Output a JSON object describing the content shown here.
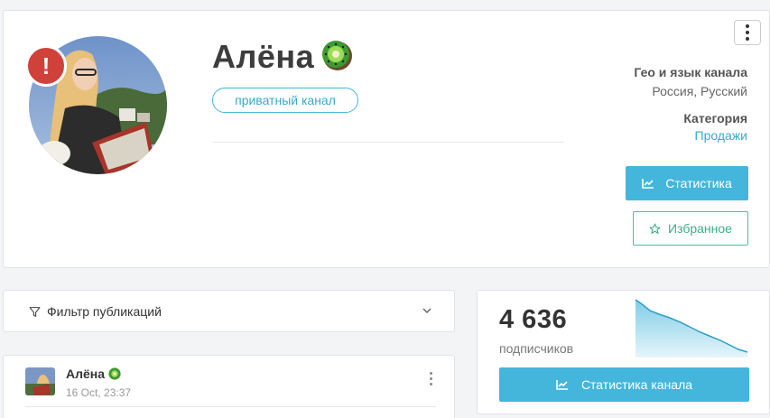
{
  "profile": {
    "name": "Алёна",
    "private_badge": "приватный канал",
    "alert_symbol": "!",
    "geo_label": "Гео и язык канала",
    "geo_value": "Россия, Русский",
    "category_label": "Категория",
    "category_value": "Продажи",
    "stats_button": "Статистика",
    "favorite_button": "Избранное",
    "icons": [
      "alert-icon",
      "kiwi-icon",
      "more-vertical-icon",
      "chart-icon",
      "star-icon"
    ]
  },
  "filter": {
    "label": "Фильтр публикаций",
    "icons": [
      "filter-icon",
      "chevron-down-icon"
    ]
  },
  "post": {
    "author": "Алёна",
    "date": "16 Oct, 23:37"
  },
  "subscribers": {
    "count": "4 636",
    "label": "подписчиков",
    "button": "Статистика канала"
  },
  "colors": {
    "accent": "#44b6dc",
    "favorite": "#4cbf9a",
    "alert": "#d0413a",
    "kiwi": "#3d9a2f"
  }
}
